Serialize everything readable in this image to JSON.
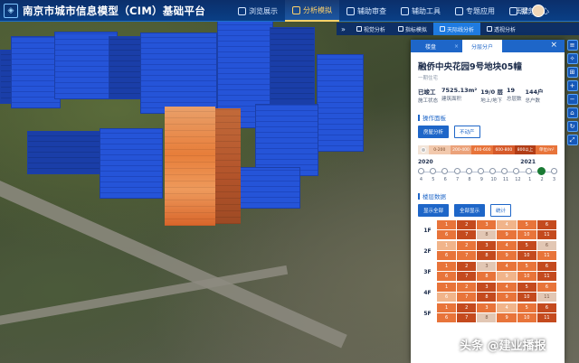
{
  "app": {
    "title": "南京市城市信息模型（CIM）基础平台"
  },
  "nav": [
    {
      "label": "浏览展示",
      "icon": "browse-icon",
      "active": false
    },
    {
      "label": "分析模拟",
      "icon": "analysis-icon",
      "active": true
    },
    {
      "label": "辅助审查",
      "icon": "review-icon",
      "active": false
    },
    {
      "label": "辅助工具",
      "icon": "tools-icon",
      "active": false
    },
    {
      "label": "专题应用",
      "icon": "topic-icon",
      "active": false
    },
    {
      "label": "服务中心",
      "icon": "service-icon",
      "active": false
    }
  ],
  "user": {
    "name": "王建"
  },
  "subbar": [
    {
      "label": "视觉分析",
      "active": false
    },
    {
      "label": "指标模拟",
      "active": false
    },
    {
      "label": "天际线分析",
      "active": true
    },
    {
      "label": "透视分析",
      "active": false
    }
  ],
  "panel": {
    "tabs": [
      "楼盘",
      "分层分户"
    ],
    "title": "融侨中央花园9号地块05幢",
    "subtitle": "一期住宅",
    "stats": [
      {
        "value": "已竣工",
        "label": "施工状态"
      },
      {
        "value": "7525.13m²",
        "label": "建筑面积"
      },
      {
        "value": "19/0 层",
        "label": "地上/地下"
      },
      {
        "value": "19",
        "label": "总层数"
      },
      {
        "value": "144户",
        "label": "总户数"
      }
    ],
    "ops_title": "操作面板",
    "ops_buttons": [
      {
        "label": "房屋分析",
        "on": true
      },
      {
        "label": "不动产",
        "on": false
      }
    ],
    "legend": [
      {
        "label": "0-200",
        "color": "#f2c9ad"
      },
      {
        "label": "200-400",
        "color": "#eba27a"
      },
      {
        "label": "400-600",
        "color": "#e8743a"
      },
      {
        "label": "600-800",
        "color": "#d65a2a"
      },
      {
        "label": "800以上",
        "color": "#b23d16"
      }
    ],
    "legend_unit": "单位/m²",
    "timeline": {
      "years": [
        "2020",
        "2021"
      ],
      "months": [
        "4",
        "5",
        "6",
        "7",
        "8",
        "9",
        "10",
        "11",
        "12",
        "1",
        "2",
        "3"
      ],
      "current_index": 10
    },
    "floors_title": "楼层数据",
    "floor_buttons": [
      "显示全部",
      "全部显示",
      "统计"
    ],
    "floors": [
      {
        "label": "1F",
        "rows": [
          [
            "1",
            "2",
            "3",
            "4",
            "5",
            "6"
          ],
          [
            "6",
            "7",
            "8",
            "9",
            "10",
            "11"
          ]
        ]
      },
      {
        "label": "2F",
        "rows": [
          [
            "1",
            "2",
            "3",
            "4",
            "5",
            "6"
          ],
          [
            "6",
            "7",
            "8",
            "9",
            "10",
            "11"
          ]
        ]
      },
      {
        "label": "3F",
        "rows": [
          [
            "1",
            "2",
            "3",
            "4",
            "5",
            "6"
          ],
          [
            "6",
            "7",
            "8",
            "9",
            "10",
            "11"
          ]
        ]
      },
      {
        "label": "4F",
        "rows": [
          [
            "1",
            "2",
            "3",
            "4",
            "5",
            "6"
          ],
          [
            "6",
            "7",
            "8",
            "9",
            "10",
            "11"
          ]
        ]
      },
      {
        "label": "5F",
        "rows": [
          [
            "1",
            "2",
            "3",
            "4",
            "5",
            "6"
          ],
          [
            "6",
            "7",
            "8",
            "9",
            "10",
            "11"
          ]
        ]
      }
    ]
  },
  "watermark": "头条 @建业播报"
}
